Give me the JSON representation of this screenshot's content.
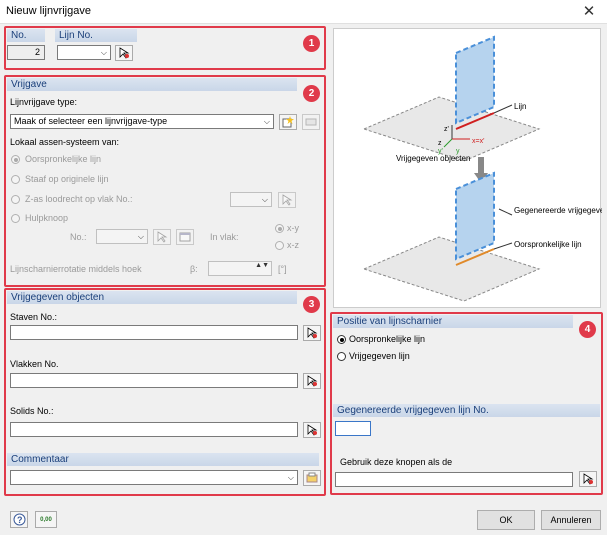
{
  "window": {
    "title": "Nieuw lijnvrijgave",
    "close": "✕"
  },
  "header": {
    "no_label": "No.",
    "no_value": "2",
    "lijn_label": "Lijn No."
  },
  "badges": [
    "1",
    "2",
    "3",
    "4"
  ],
  "vrijgave": {
    "title": "Vrijgave",
    "type_label": "Lijnvrijgave type:",
    "type_value": "Maak of selecteer een lijnvrijgave-type",
    "axes_label": "Lokaal assen-systeem van:",
    "options": [
      "Oorspronkelijke lijn",
      "Staaf op originele lijn",
      "Z-as loodrecht op vlak No.:",
      "Hulpknoop"
    ],
    "no_label": "No.:",
    "in_vlak_label": "In vlak:",
    "plane_options": [
      "x-y",
      "x-z"
    ],
    "rotation_label": "Lijnscharnierrotatie middels hoek",
    "beta_label": "β:",
    "unit": "[°]"
  },
  "objects": {
    "title": "Vrijgegeven objecten",
    "staven": "Staven No.:",
    "vlakken": "Vlakken No.",
    "solids": "Solids No.:"
  },
  "comment": {
    "title": "Commentaar"
  },
  "diagram": {
    "lijn": "Lijn",
    "vrijgegeven_objecten": "Vrijgegeven objecten",
    "gegenereerde": "Gegenereerde vrijgegeven lijn",
    "oorspronkelijke": "Oorspronkelijke lijn",
    "axis_z": "z'",
    "axis_x": "x=x'",
    "axis_y": "y'",
    "axis_z2": "z",
    "axis_y2": "y"
  },
  "position": {
    "title": "Positie van lijnscharnier",
    "options": [
      "Oorspronkelijke lijn",
      "Vrijgegeven lijn"
    ]
  },
  "generated": {
    "title": "Gegenereerde vrijgegeven lijn No.",
    "hint": "Gebruik deze knopen als de"
  },
  "footer": {
    "ok": "OK",
    "cancel": "Annuleren",
    "units": "0,00"
  },
  "colors": {
    "accent": "#e03a4a",
    "header_text": "#1a3f7a"
  }
}
